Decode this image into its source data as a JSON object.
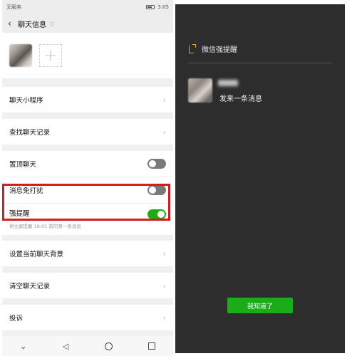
{
  "left": {
    "status_bar": {
      "carrier": "无服务",
      "time": "3:05"
    },
    "title": "聊天信息",
    "menu_mini_program": "聊天小程序",
    "menu_search_history": "查找聊天记录",
    "menu_pin_chat": "置顶聊天",
    "menu_mute": "消息免打扰",
    "strong_remind": {
      "title": "强提醒",
      "desc": "将全屏提醒 18:05 前的第一条消息"
    },
    "menu_background": "设置当前聊天背景",
    "menu_clear_history": "清空聊天记录",
    "menu_report": "投诉",
    "icons": {
      "back": "‹",
      "chevron": "›",
      "add": "+",
      "nav_down": "⌄",
      "nav_back": "◁"
    },
    "colors": {
      "switch_on": "#1aad19",
      "highlight": "#d71a1a"
    }
  },
  "right": {
    "header": "微信强提醒",
    "message": "发来一条消息",
    "button_label": "我知道了",
    "colors": {
      "background": "#2d2d2d",
      "button": "#1aad19",
      "bell": "#f0a500"
    }
  }
}
